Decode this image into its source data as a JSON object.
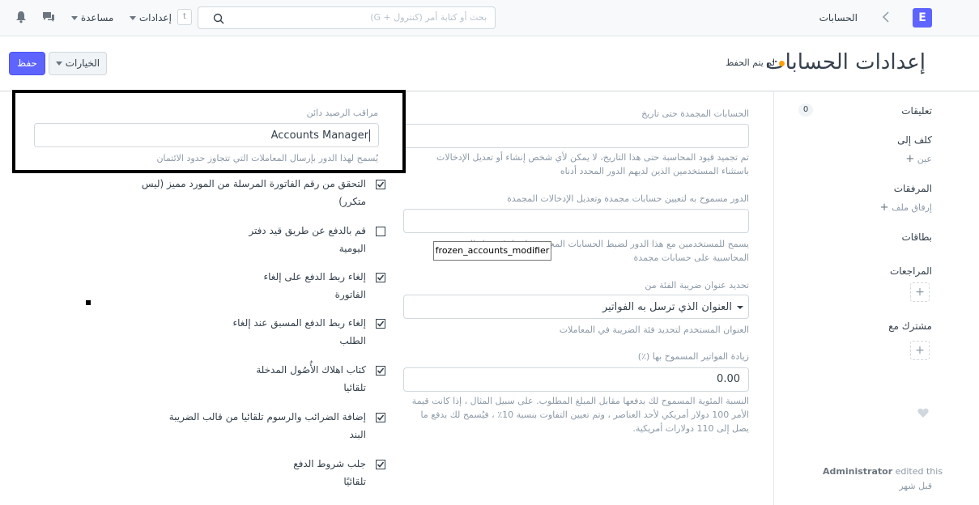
{
  "navbar": {
    "logo_letter": "E",
    "breadcrumb": "الحسابات",
    "search_placeholder": "بحث أو كتابة أمر (كنترول + G)",
    "shortcut_key": "t",
    "settings_label": "إعدادات",
    "help_label": "مساعدة"
  },
  "page": {
    "title": "إعدادات الحسابات",
    "status": "لم يتم الحفظ",
    "options_label": "الخيارات",
    "save_label": "حفظ"
  },
  "sidebar": {
    "comments_label": "تعليقات",
    "comments_count": "0",
    "assigned_label": "كلف إلى",
    "assign_link": "عين",
    "attachments_label": "المرفقات",
    "attach_link": "إرفاق ملف",
    "tags_label": "بطاقات",
    "reviews_label": "المراجعات",
    "shared_label": "مشترك مع",
    "editor_name": "Administrator",
    "editor_action": "edited this",
    "edited_time": "قبل شهر"
  },
  "form": {
    "frozen_date_label": "الحسابات المجمدة حتى تاريخ",
    "frozen_date_value": "",
    "frozen_date_desc": "تم تجميد قيود المحاسبة حتى هذا التاريخ، لا يمكن لأي شخص إنشاء أو تعديل الإدخالات باستثناء المستخدمين الذين لديهم الدور المحدد أدناه",
    "frozen_role_label": "الدور مسموح به لتعيين حسابات مجمدة وتعديل الإدخالات المجمدة",
    "frozen_role_value": "",
    "frozen_role_desc": "يسمح للمستخدمين مع هذا الدور لضبط الحسابات المجمدة وإنشاء / تعديل القيود المحاسبية على حسابات مجمدة",
    "tooltip": "frozen_accounts_modifier",
    "tax_address_label": "تحديد عنوان ضريبة الفئة من",
    "tax_address_value": "العنوان الذي ترسل به الفواتير",
    "tax_address_desc": "العنوان المستخدم لتحديد فئة الضريبة في المعاملات",
    "overbilling_label": "زيادة الفواتير المسموح بها (٪)",
    "overbilling_value": "0.00",
    "overbilling_desc": "النسبة المئوية المسموح لك بدفعها مقابل المبلغ المطلوب. على سبيل المثال ، إذا كانت قيمة الأمر 100 دولار أمريكي لأحد العناصر ، وتم تعيين التفاوت بنسبة 10٪ ، فيُسمح لك بدفع ما يصل إلى 110 دولارات أمريكية.",
    "credit_controller_label": "مراقب الرصيد دائن",
    "credit_controller_value": "Accounts Manager",
    "credit_controller_desc": "يُسمح لهذا الدور بإرسال المعاملات التي تتجاوز حدود الائتمان"
  },
  "checkboxes": [
    {
      "line1": "التحقق من رقم الفاتورة المرسلة من المورد مميز (ليس",
      "line2": "متكرر)",
      "checked": true
    },
    {
      "line1": "قم بالدفع عن طريق قيد دفتر",
      "line2": "اليومية",
      "checked": false
    },
    {
      "line1": "إلغاء ربط الدفع على إلغاء",
      "line2": "الفاتورة",
      "checked": true
    },
    {
      "line1": "إلغاء ربط الدفع المسبق عند إلغاء",
      "line2": "الطلب",
      "checked": true
    },
    {
      "line1": "كتاب اهلاك الأُصُول المدخلة",
      "line2": "تلقائيا",
      "checked": true
    },
    {
      "line1": "إضافة الضرائب والرسوم تلقائيا من قالب الضريبة",
      "line2": "البند",
      "checked": true
    },
    {
      "line1": "جلب شروط الدفع",
      "line2": "تلقائيًا",
      "checked": true
    }
  ],
  "colors": {
    "primary": "#5e64ff",
    "unsaved_dot": "#ffa00a"
  }
}
